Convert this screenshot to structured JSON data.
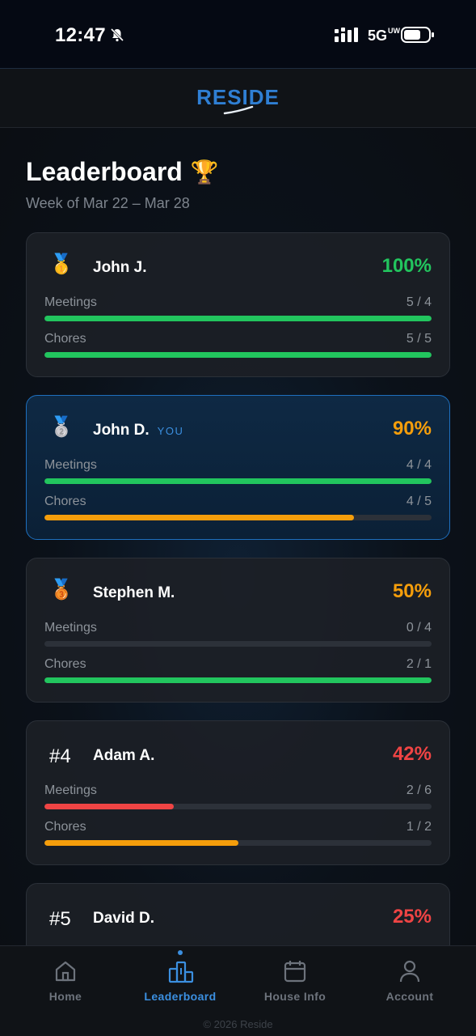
{
  "status_bar": {
    "time": "12:47",
    "network": "5G",
    "network_sup": "UW"
  },
  "app": {
    "logo": "RESIDE"
  },
  "page": {
    "title": "Leaderboard",
    "title_icon": "🏆",
    "subtitle": "Week of Mar 22 – Mar 28"
  },
  "labels": {
    "meetings": "Meetings",
    "chores": "Chores"
  },
  "colors": {
    "green": "#22c55e",
    "orange": "#f59e0b",
    "red": "#ef4444",
    "accent": "#3b8fe0"
  },
  "entries": [
    {
      "rank": "🥇",
      "name": "John J.",
      "you": "",
      "pct": "100%",
      "pct_color": "green",
      "meetings": {
        "value": "5 / 4",
        "progress": 1.0,
        "color": "green"
      },
      "chores": {
        "value": "5 / 5",
        "progress": 1.0,
        "color": "green"
      }
    },
    {
      "rank": "🥈",
      "name": "John D.",
      "you": "YOU",
      "pct": "90%",
      "pct_color": "orange",
      "meetings": {
        "value": "4 / 4",
        "progress": 1.0,
        "color": "green"
      },
      "chores": {
        "value": "4 / 5",
        "progress": 0.8,
        "color": "orange"
      }
    },
    {
      "rank": "🥉",
      "name": "Stephen M.",
      "you": "",
      "pct": "50%",
      "pct_color": "orange",
      "meetings": {
        "value": "0 / 4",
        "progress": 0.0,
        "color": "red"
      },
      "chores": {
        "value": "2 / 1",
        "progress": 1.0,
        "color": "green"
      }
    },
    {
      "rank": "#4",
      "name": "Adam A.",
      "you": "",
      "pct": "42%",
      "pct_color": "red",
      "meetings": {
        "value": "2 / 6",
        "progress": 0.333,
        "color": "red"
      },
      "chores": {
        "value": "1 / 2",
        "progress": 0.5,
        "color": "orange"
      }
    },
    {
      "rank": "#5",
      "name": "David D.",
      "you": "",
      "pct": "25%",
      "pct_color": "red"
    }
  ],
  "tabs": [
    {
      "label": "Home",
      "icon": "home-icon",
      "active": false
    },
    {
      "label": "Leaderboard",
      "icon": "leaderboard-icon",
      "active": true
    },
    {
      "label": "House Info",
      "icon": "calendar-icon",
      "active": false
    },
    {
      "label": "Account",
      "icon": "account-icon",
      "active": false
    }
  ],
  "footer": {
    "copyright": "© 2026 Reside"
  }
}
